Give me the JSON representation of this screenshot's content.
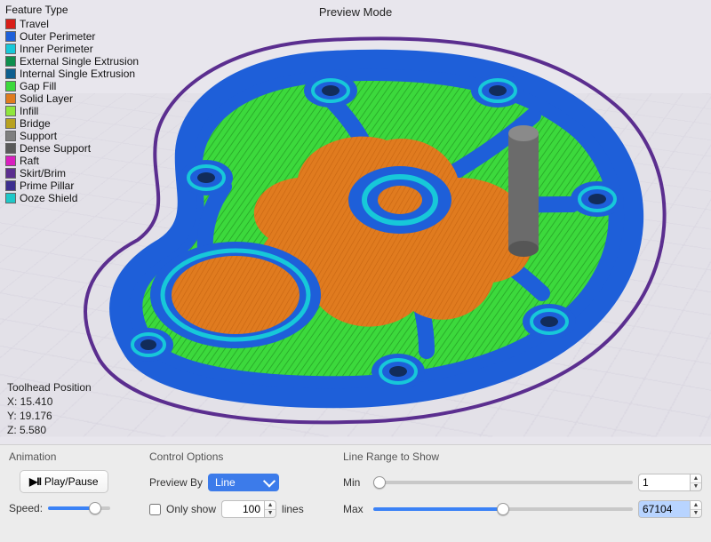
{
  "title": "Preview Mode",
  "legend": {
    "title": "Feature Type",
    "items": [
      {
        "label": "Travel",
        "color": "#D91E18"
      },
      {
        "label": "Outer Perimeter",
        "color": "#1E5FD9"
      },
      {
        "label": "Inner Perimeter",
        "color": "#17C8D9"
      },
      {
        "label": "External Single Extrusion",
        "color": "#0E8F4E"
      },
      {
        "label": "Internal Single Extrusion",
        "color": "#0E5F8F"
      },
      {
        "label": "Gap Fill",
        "color": "#3CD93C"
      },
      {
        "label": "Solid Layer",
        "color": "#E07B1F"
      },
      {
        "label": "Infill",
        "color": "#8FE63C"
      },
      {
        "label": "Bridge",
        "color": "#B8A11F"
      },
      {
        "label": "Support",
        "color": "#7F7F7F"
      },
      {
        "label": "Dense Support",
        "color": "#5A5A5A"
      },
      {
        "label": "Raft",
        "color": "#D91EBF"
      },
      {
        "label": "Skirt/Brim",
        "color": "#5B2E8F"
      },
      {
        "label": "Prime Pillar",
        "color": "#3C2E8F"
      },
      {
        "label": "Ooze Shield",
        "color": "#1EC8C8"
      }
    ]
  },
  "toolhead": {
    "title": "Toolhead Position",
    "x_label": "X: 15.410",
    "y_label": "Y: 19.176",
    "z_label": "Z: 5.580"
  },
  "controls": {
    "animation": {
      "title": "Animation",
      "play_label": "Play/Pause",
      "speed_label": "Speed:"
    },
    "options": {
      "title": "Control Options",
      "preview_by_label": "Preview By",
      "preview_by_value": "Line",
      "only_show_label": "Only show",
      "only_show_value": "100",
      "only_show_suffix": "lines"
    },
    "range": {
      "title": "Line Range to Show",
      "min_label": "Min",
      "min_value": "1",
      "max_label": "Max",
      "max_value": "67104",
      "slider_min": 1,
      "slider_max": 134208,
      "min_slider_at": 1,
      "max_slider_at": 67104
    }
  },
  "colors": {
    "outer": "#1E5FD9",
    "inner": "#17C8D9",
    "infill": "#3CD93C",
    "solid": "#E07B1F",
    "brim": "#5B2E8F",
    "support": "#6B6B6B"
  }
}
